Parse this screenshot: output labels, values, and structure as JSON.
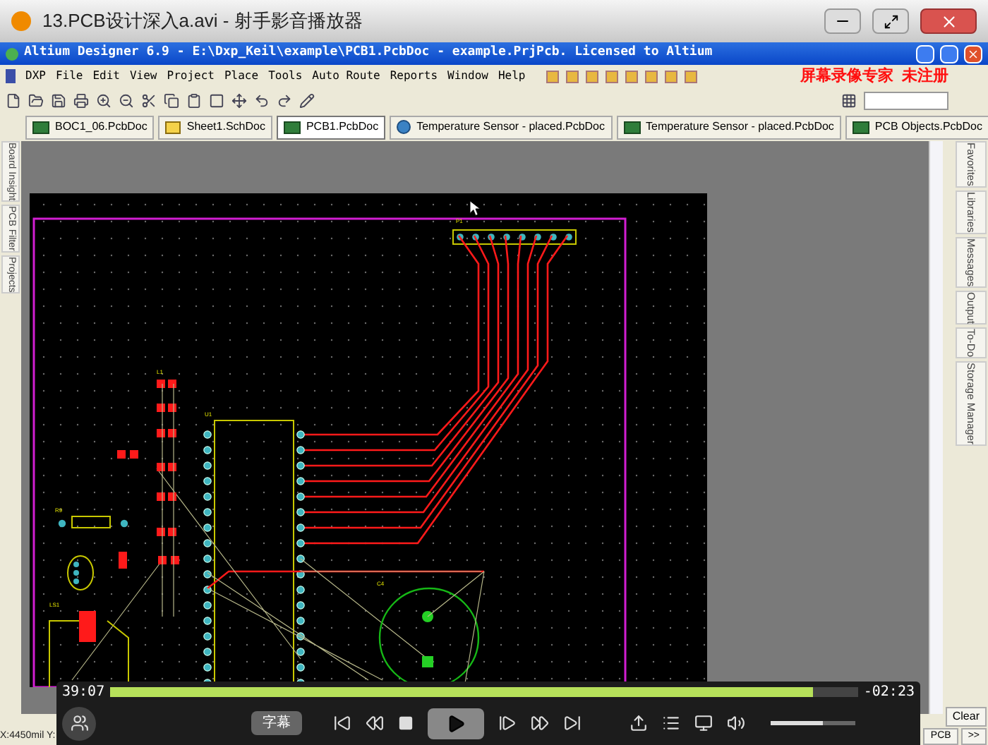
{
  "player_window": {
    "title": "13.PCB设计深入a.avi - 射手影音播放器"
  },
  "app_window": {
    "title": "Altium Designer 6.9 - E:\\Dxp_Keil\\example\\PCB1.PcbDoc - example.PrjPcb. Licensed to Altium"
  },
  "menu": [
    "DXP",
    "File",
    "Edit",
    "View",
    "Project",
    "Place",
    "Tools",
    "Auto Route",
    "Reports",
    "Window",
    "Help"
  ],
  "recorder_notice": "屏幕录像专家  未注册",
  "document_tabs": [
    {
      "label": "BOC1_06.PcbDoc",
      "kind": "pcb",
      "selected": false
    },
    {
      "label": "Sheet1.SchDoc",
      "kind": "sch",
      "selected": false
    },
    {
      "label": "PCB1.PcbDoc",
      "kind": "pcb",
      "selected": true
    },
    {
      "label": "Temperature Sensor - placed.PcbDoc",
      "kind": "web",
      "selected": false
    },
    {
      "label": "Temperature Sensor - placed.PcbDoc",
      "kind": "pcb",
      "selected": false
    },
    {
      "label": "PCB Objects.PcbDoc",
      "kind": "pcb",
      "selected": false
    }
  ],
  "pcb_labels": [
    "P1",
    "L1",
    "U1",
    "R9",
    "LS1",
    "C4"
  ],
  "left_panels": [
    "Board Insight",
    "PCB Filter",
    "Projects"
  ],
  "right_panels": [
    "Favorites",
    "Libraries",
    "Messages",
    "Output",
    "To-Do",
    "Storage Manager"
  ],
  "status_bar": {
    "coordinates": "X:4450mil Y:",
    "clear_button": "Clear",
    "pcb_button": "PCB",
    "more_button": ">>"
  },
  "player": {
    "elapsed": "39:07",
    "remaining": "-02:23",
    "progress": {
      "level": 0.94
    },
    "subtitle_button": "字幕",
    "volume": {
      "level": 0.62
    }
  }
}
